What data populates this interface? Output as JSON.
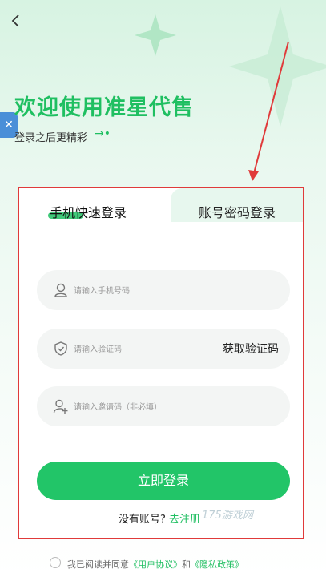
{
  "header": {
    "title": "欢迎使用准星代售",
    "subtitle": "登录之后更精彩",
    "subtitle_arrow": "→•"
  },
  "side_tab_icon": "tools-icon",
  "tabs": [
    {
      "label": "手机快速登录",
      "active": true
    },
    {
      "label": "账号密码登录",
      "active": false
    }
  ],
  "form": {
    "phone_placeholder": "请输入手机号码",
    "code_placeholder": "请输入验证码",
    "get_code_label": "获取验证码",
    "invite_placeholder": "请输入邀请码（非必填）"
  },
  "login_button": "立即登录",
  "register": {
    "prompt": "没有账号?",
    "link": "去注册"
  },
  "agreement": {
    "prefix": "我已阅读并同意",
    "user_agreement": "《用户协议》",
    "and": "和",
    "privacy_policy": "《隐私政策》"
  },
  "watermark": "175游戏网",
  "colors": {
    "accent": "#1fbf61",
    "highlight_border": "#e03a3a"
  }
}
